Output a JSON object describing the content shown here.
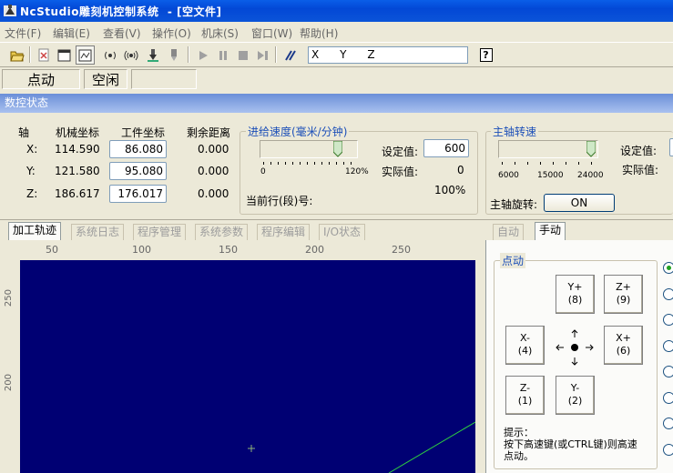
{
  "window": {
    "title": "NcStudio雕刻机控制系统  - [空文件]"
  },
  "menu": [
    "文件(F)",
    "编辑(E)",
    "查看(V)",
    "操作(O)",
    "机床(S)",
    "窗口(W)",
    "帮助(H)"
  ],
  "toolbar": {
    "coord_display": "X      Y      Z",
    "help_label": "?"
  },
  "status": {
    "mode": "点动",
    "state": "空闲",
    "extra": ""
  },
  "nc_panel": {
    "header": "数控状态",
    "columns": [
      "轴",
      "机械坐标",
      "工件坐标",
      "剩余距离"
    ],
    "rows": [
      {
        "axis": "X:",
        "machine": "114.590",
        "work": "86.080",
        "remaining": "0.000"
      },
      {
        "axis": "Y:",
        "machine": "121.580",
        "work": "95.080",
        "remaining": "0.000"
      },
      {
        "axis": "Z:",
        "machine": "186.617",
        "work": "176.017",
        "remaining": "0.000"
      }
    ],
    "feed": {
      "title": "进给速度(毫米/分钟)",
      "scale_min": "0",
      "scale_max": "120%",
      "set_label": "设定值:",
      "set_value": "600",
      "actual_label": "实际值:",
      "actual_value": "0",
      "percent": "100%",
      "current_line_label": "当前行(段)号:"
    },
    "spindle": {
      "title": "主轴转速",
      "ticks": [
        "6000",
        "15000",
        "24000"
      ],
      "set_label": "设定值:",
      "actual_label": "实际值:",
      "rotation_label": "主轴旋转:",
      "rotation_button": "ON"
    }
  },
  "tabs": [
    "加工轨迹",
    "系统日志",
    "程序管理",
    "系统参数",
    "程序编辑",
    "I/O状态"
  ],
  "ruler": {
    "x_ticks": [
      "50",
      "100",
      "150",
      "200",
      "250"
    ],
    "y_ticks": [
      "250",
      "200"
    ]
  },
  "right_tabs": [
    "自动",
    "手动"
  ],
  "manual": {
    "group_title": "点动",
    "buttons": {
      "y_plus": [
        "Y+",
        "(8)"
      ],
      "z_plus": [
        "Z+",
        "(9)"
      ],
      "x_minus": [
        "X-",
        "(4)"
      ],
      "x_plus": [
        "X+",
        "(6)"
      ],
      "z_minus": [
        "Z-",
        "(1)"
      ],
      "y_minus": [
        "Y-",
        "(2)"
      ]
    },
    "hint": [
      "提示：",
      "按下高速键(或CTRL键)则高速",
      "点动。"
    ]
  }
}
